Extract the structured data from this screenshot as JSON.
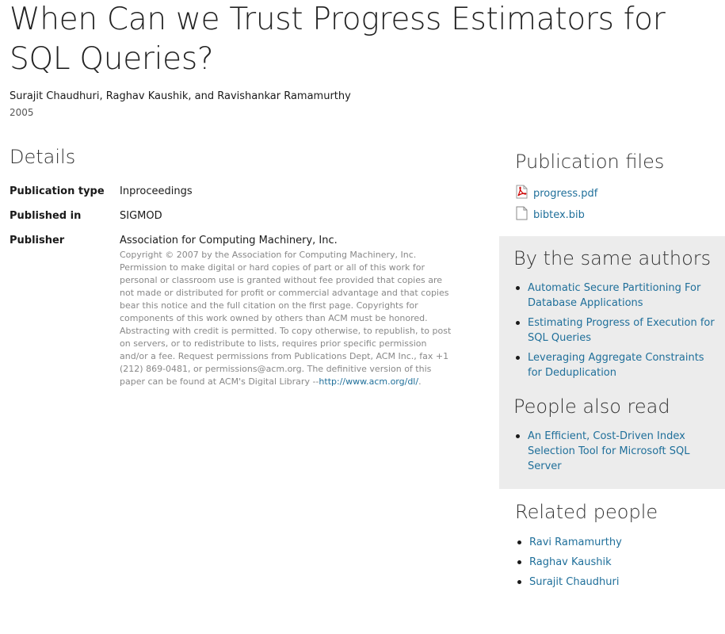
{
  "page": {
    "title": "When Can we Trust Progress Estimators for SQL Queries?",
    "authors": "Surajit Chaudhuri, Raghav Kaushik, and Ravishankar Ramamurthy",
    "year": "2005"
  },
  "details": {
    "heading": "Details",
    "rows": [
      {
        "label": "Publication type",
        "value": "Inproceedings"
      },
      {
        "label": "Published in",
        "value": "SIGMOD"
      },
      {
        "label": "Publisher",
        "value": "Association for Computing Machinery, Inc."
      }
    ],
    "copyright_text": "Copyright © 2007 by the Association for Computing Machinery, Inc. Permission to make digital or hard copies of part or all of this work for personal or classroom use is granted without fee provided that copies are not made or distributed for profit or commercial advantage and that copies bear this notice and the full citation on the first page. Copyrights for components of this work owned by others than ACM must be honored. Abstracting with credit is permitted. To copy otherwise, to republish, to post on servers, or to redistribute to lists, requires prior specific permission and/or a fee. Request permissions from Publications Dept, ACM Inc., fax +1 (212) 869-0481, or permissions@acm.org. The definitive version of this paper can be found at ACM's Digital Library --",
    "copyright_link": "http://www.acm.org/dl/",
    "copyright_end": "."
  },
  "publication_files": {
    "heading": "Publication files",
    "files": [
      {
        "name": "progress.pdf",
        "icon": "pdf-file-icon"
      },
      {
        "name": "bibtex.bib",
        "icon": "document-file-icon"
      }
    ]
  },
  "same_authors": {
    "heading": "By the same authors",
    "items": [
      "Automatic Secure Partitioning For Database Applications",
      "Estimating Progress of Execution for SQL Queries",
      "Leveraging Aggregate Constraints for Deduplication"
    ]
  },
  "people_also_read": {
    "heading": "People also read",
    "items": [
      "An Efficient, Cost-Driven Index Selection Tool for Microsoft SQL Server"
    ]
  },
  "related_people": {
    "heading": "Related people",
    "items": [
      "Ravi Ramamurthy",
      "Raghav Kaushik",
      "Surajit Chaudhuri"
    ]
  },
  "colors": {
    "link": "#1f6f9a",
    "panel_bg": "#ececec",
    "muted_text": "#888888"
  }
}
